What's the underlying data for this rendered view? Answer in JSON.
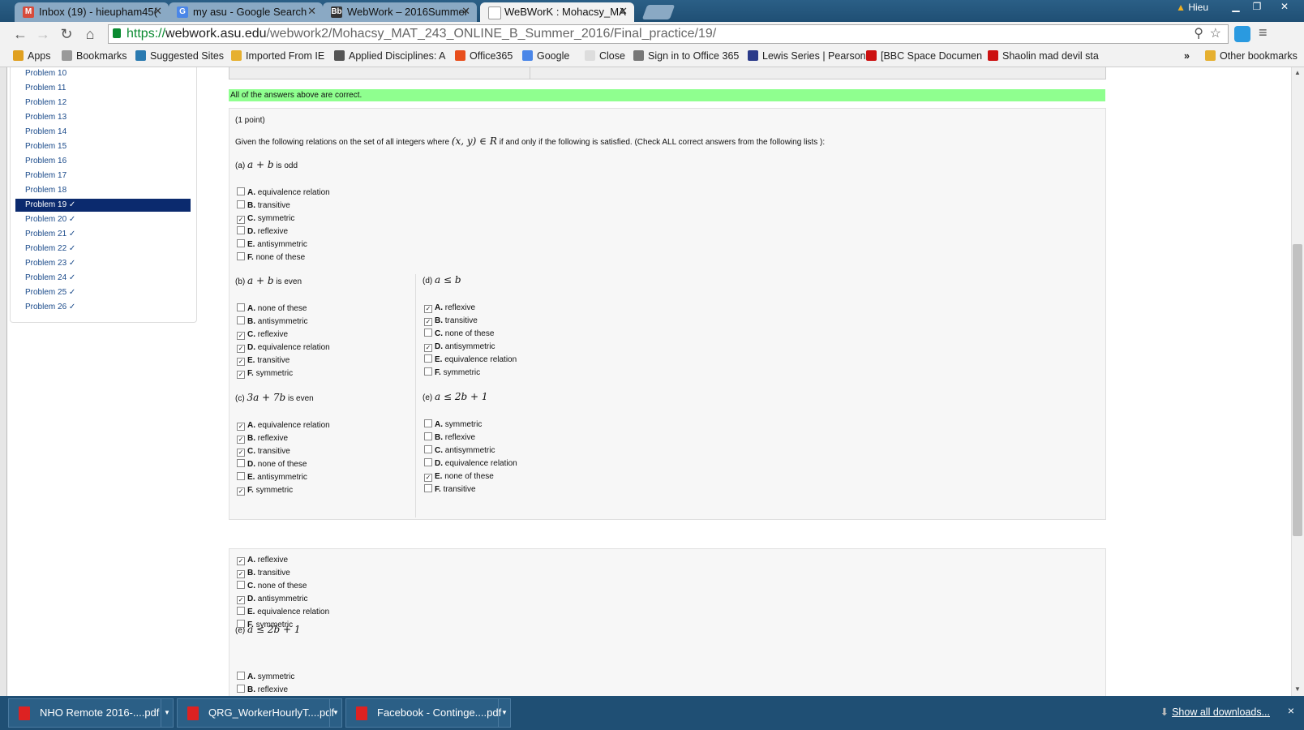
{
  "browser": {
    "tabs": [
      {
        "label": "Inbox (19) - hieupham45(",
        "icon_color": "#d64b3b",
        "icon": "gmail-icon"
      },
      {
        "label": "my asu - Google Search",
        "icon_color": "#4a86e8",
        "icon": "google-icon"
      },
      {
        "label": "WebWork – 2016Summer",
        "icon_color": "#333333",
        "icon": "blackboard-icon"
      },
      {
        "label": "WeBWorK : Mohacsy_MA",
        "icon_color": "#eeeeee",
        "icon": "page-icon"
      }
    ],
    "user": "Hieu",
    "url": {
      "scheme": "https://",
      "host": "webwork.asu.edu",
      "path": "/webwork2/Mohacsy_MAT_243_ONLINE_B_Summer_2016/Final_practice/19/"
    },
    "bookmarks": [
      {
        "label": "Apps",
        "color": "#e0a020"
      },
      {
        "label": "Bookmarks",
        "color": "#999999"
      },
      {
        "label": "Suggested Sites",
        "color": "#2a7ab0"
      },
      {
        "label": "Imported From IE",
        "color": "#e6b030"
      },
      {
        "label": "Applied Disciplines: A",
        "color": "#555555"
      },
      {
        "label": "Office365",
        "color": "#e84e1c"
      },
      {
        "label": "Google",
        "color": "#4a86e8"
      },
      {
        "label": "Close",
        "color": "#dddddd"
      },
      {
        "label": "Sign in to Office 365",
        "color": "#777777"
      },
      {
        "label": "Lewis Series | Pearson",
        "color": "#2a3a8a"
      },
      {
        "label": "[BBC Space Documen",
        "color": "#cc1111"
      },
      {
        "label": "Shaolin mad devil sta",
        "color": "#cc1111"
      }
    ],
    "overflow": "»",
    "other_bookmarks": "Other bookmarks"
  },
  "sidebar": {
    "problems": [
      {
        "label": "Problem 10"
      },
      {
        "label": "Problem 11"
      },
      {
        "label": "Problem 12"
      },
      {
        "label": "Problem 13"
      },
      {
        "label": "Problem 14"
      },
      {
        "label": "Problem 15"
      },
      {
        "label": "Problem 16"
      },
      {
        "label": "Problem 17"
      },
      {
        "label": "Problem 18"
      },
      {
        "label": "Problem 19 ✓",
        "active": true
      },
      {
        "label": "Problem 20 ✓"
      },
      {
        "label": "Problem 21 ✓"
      },
      {
        "label": "Problem 22 ✓"
      },
      {
        "label": "Problem 23 ✓"
      },
      {
        "label": "Problem 24 ✓"
      },
      {
        "label": "Problem 25 ✓"
      },
      {
        "label": "Problem 26 ✓"
      }
    ]
  },
  "problem": {
    "banner": "All of the answers above are correct.",
    "points": "(1 point)",
    "intro_before": "Given the following relations on the set of all integers where",
    "intro_math1": "(x, y) ∈ R",
    "intro_after": "if and only if the following is satisfied. (Check ALL correct answers from the following lists ):",
    "parts": {
      "a": {
        "label": "(a)",
        "math": "a + b",
        "suffix": "is odd",
        "options": [
          {
            "letter": "A.",
            "text": "equivalence relation",
            "checked": false
          },
          {
            "letter": "B.",
            "text": "transitive",
            "checked": false
          },
          {
            "letter": "C.",
            "text": "symmetric",
            "checked": true
          },
          {
            "letter": "D.",
            "text": "reflexive",
            "checked": false
          },
          {
            "letter": "E.",
            "text": "antisymmetric",
            "checked": false
          },
          {
            "letter": "F.",
            "text": "none of these",
            "checked": false
          }
        ]
      },
      "b": {
        "label": "(b)",
        "math": "a + b",
        "suffix": "is even",
        "options": [
          {
            "letter": "A.",
            "text": "none of these",
            "checked": false
          },
          {
            "letter": "B.",
            "text": "antisymmetric",
            "checked": false
          },
          {
            "letter": "C.",
            "text": "reflexive",
            "checked": true
          },
          {
            "letter": "D.",
            "text": "equivalence relation",
            "checked": true
          },
          {
            "letter": "E.",
            "text": "transitive",
            "checked": true
          },
          {
            "letter": "F.",
            "text": "symmetric",
            "checked": true
          }
        ]
      },
      "c": {
        "label": "(c)",
        "math": "3a + 7b",
        "suffix": "is even",
        "options": [
          {
            "letter": "A.",
            "text": "equivalence relation",
            "checked": true
          },
          {
            "letter": "B.",
            "text": "reflexive",
            "checked": true
          },
          {
            "letter": "C.",
            "text": "transitive",
            "checked": true
          },
          {
            "letter": "D.",
            "text": "none of these",
            "checked": false
          },
          {
            "letter": "E.",
            "text": "antisymmetric",
            "checked": false
          },
          {
            "letter": "F.",
            "text": "symmetric",
            "checked": true
          }
        ]
      },
      "d": {
        "label": "(d)",
        "math": "a ≤ b",
        "suffix": "",
        "options": [
          {
            "letter": "A.",
            "text": "reflexive",
            "checked": true
          },
          {
            "letter": "B.",
            "text": "transitive",
            "checked": true
          },
          {
            "letter": "C.",
            "text": "none of these",
            "checked": false
          },
          {
            "letter": "D.",
            "text": "antisymmetric",
            "checked": true
          },
          {
            "letter": "E.",
            "text": "equivalence relation",
            "checked": false
          },
          {
            "letter": "F.",
            "text": "symmetric",
            "checked": false
          }
        ]
      },
      "e": {
        "label": "(e)",
        "math": "a ≤ 2b + 1",
        "suffix": "",
        "options": [
          {
            "letter": "A.",
            "text": "symmetric",
            "checked": false
          },
          {
            "letter": "B.",
            "text": "reflexive",
            "checked": false
          },
          {
            "letter": "C.",
            "text": "antisymmetric",
            "checked": false
          },
          {
            "letter": "D.",
            "text": "equivalence relation",
            "checked": false
          },
          {
            "letter": "E.",
            "text": "none of these",
            "checked": true
          },
          {
            "letter": "F.",
            "text": "transitive",
            "checked": false
          }
        ]
      }
    }
  },
  "lower": {
    "options_d": [
      {
        "letter": "A.",
        "text": "reflexive",
        "checked": true
      },
      {
        "letter": "B.",
        "text": "transitive",
        "checked": true
      },
      {
        "letter": "C.",
        "text": "none of these",
        "checked": false
      },
      {
        "letter": "D.",
        "text": "antisymmetric",
        "checked": true
      },
      {
        "letter": "E.",
        "text": "equivalence relation",
        "checked": false
      },
      {
        "letter": "F.",
        "text": "symmetric",
        "checked": false
      }
    ],
    "part_e_label": "(e)",
    "part_e_math": "a ≤ 2b + 1",
    "options_e": [
      {
        "letter": "A.",
        "text": "symmetric",
        "checked": false
      },
      {
        "letter": "B.",
        "text": "reflexive",
        "checked": false
      }
    ]
  },
  "downloads": {
    "items": [
      "NHO Remote 2016-....pdf",
      "QRG_WorkerHourlyT....pdf",
      "Facebook - Continge....pdf"
    ],
    "show_all": "Show all downloads...",
    "close": "×"
  }
}
